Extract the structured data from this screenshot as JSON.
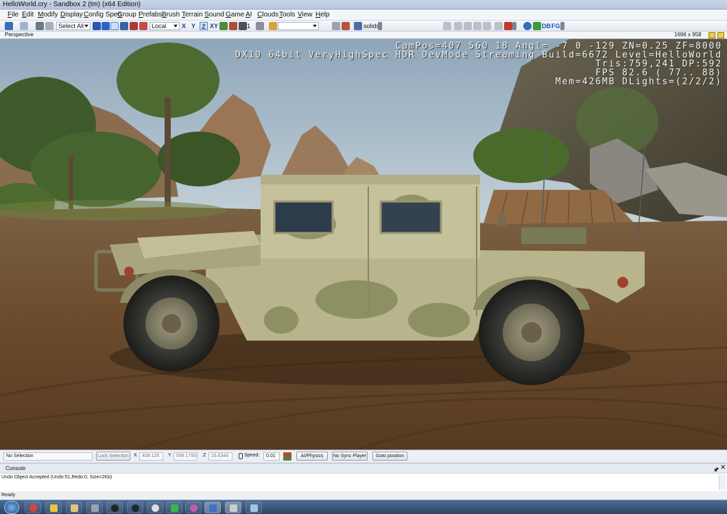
{
  "window": {
    "title": "HelloWorld.cry - Sandbox 2 (tm) (x64 Edition)"
  },
  "menu": [
    "File",
    "Edit",
    "Modify",
    "Display",
    "Config Spec",
    "Group",
    "Prefabs",
    "Brush",
    "Terrain",
    "Sound",
    "Game",
    "AI",
    "Clouds",
    "Tools",
    "View",
    "Help"
  ],
  "toolbar": {
    "select_all": "Select All",
    "coord_space": "Local",
    "axis_x": "X",
    "axis_y": "Y",
    "axis_z": "Z",
    "axis_xy": "XY",
    "layer_num": "1",
    "render_mode": "solids"
  },
  "viewport": {
    "name": "Perspective",
    "resolution": "1696 x 958",
    "hud": [
      "CamPos=407 560  18 Angl= -7  0 -129 ZN=0.25 ZF=8000",
      "DX10 64bit VeryHighSpec HDR DevMode Streaming Build=6672 Level=HelloWorld",
      "Tris:759,241  DP:592",
      "FPS  82.6 ( 77.. 88)",
      "Mem=426MB DLights=(2/2/2)"
    ]
  },
  "status": {
    "selection": "No Selection",
    "lock_selection": "Lock Selection",
    "x_label": "X",
    "x_value": "408.126",
    "y_label": "Y",
    "y_value": "556.1793",
    "z_label": "Z",
    "z_value": "16.6344",
    "speed_label": "Speed:",
    "speed_value": "0.01",
    "ai_physics": "AI/Physics",
    "no_sync_player": "No Sync Player",
    "goto_position": "Goto position"
  },
  "console": {
    "title": "Console",
    "line": "Undo Object Accepted (Undo:51,Redo:0, Size=2Kb)",
    "ready": "Ready"
  },
  "colors": {
    "sky": "#a7bccd",
    "ground": "#6b4b2c",
    "humvee": "#b8b48c",
    "taskbar": "#2b4566"
  }
}
